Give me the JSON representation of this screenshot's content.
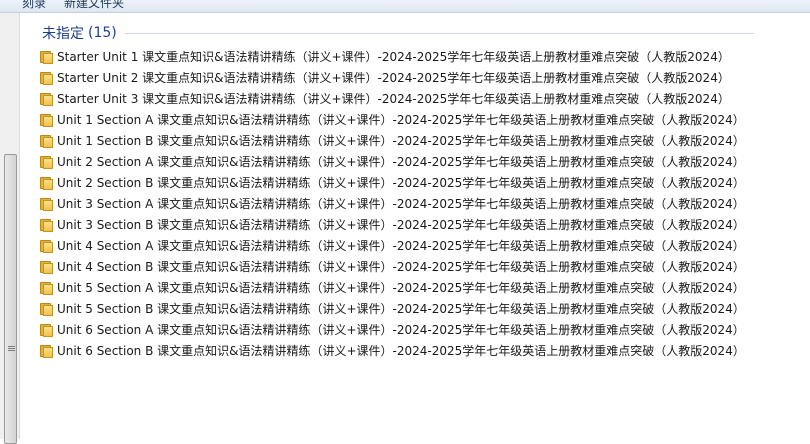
{
  "toolbar": {
    "left_label": "刻录",
    "right_label": "新建文件夹"
  },
  "group": {
    "title": "未指定",
    "count": "(15)"
  },
  "items": [
    {
      "label": "Starter Unit 1  课文重点知识&语法精讲精练（讲义+课件）-2024-2025学年七年级英语上册教材重难点突破（人教版2024）"
    },
    {
      "label": "Starter Unit 2 课文重点知识&语法精讲精练（讲义+课件）-2024-2025学年七年级英语上册教材重难点突破（人教版2024）"
    },
    {
      "label": "Starter Unit 3 课文重点知识&语法精讲精练（讲义+课件）-2024-2025学年七年级英语上册教材重难点突破（人教版2024）"
    },
    {
      "label": "Unit 1 Section A 课文重点知识&语法精讲精练（讲义+课件）-2024-2025学年七年级英语上册教材重难点突破（人教版2024）"
    },
    {
      "label": "Unit 1 Section B 课文重点知识&语法精讲精练（讲义+课件）-2024-2025学年七年级英语上册教材重难点突破（人教版2024）"
    },
    {
      "label": "Unit 2 Section A 课文重点知识&语法精讲精练（讲义+课件）-2024-2025学年七年级英语上册教材重难点突破（人教版2024）"
    },
    {
      "label": "Unit 2 Section B 课文重点知识&语法精讲精练（讲义+课件）-2024-2025学年七年级英语上册教材重难点突破（人教版2024）"
    },
    {
      "label": "Unit 3 Section A 课文重点知识&语法精讲精练（讲义+课件）-2024-2025学年七年级英语上册教材重难点突破（人教版2024）"
    },
    {
      "label": "Unit 3 Section B 课文重点知识&语法精讲精练（讲义+课件）-2024-2025学年七年级英语上册教材重难点突破（人教版2024）"
    },
    {
      "label": "Unit 4 Section A 课文重点知识&语法精讲精练（讲义+课件）-2024-2025学年七年级英语上册教材重难点突破（人教版2024）"
    },
    {
      "label": "Unit 4 Section B 课文重点知识&语法精讲精练（讲义+课件）-2024-2025学年七年级英语上册教材重难点突破（人教版2024）"
    },
    {
      "label": "Unit 5 Section A 课文重点知识&语法精讲精练（讲义+课件）-2024-2025学年七年级英语上册教材重难点突破（人教版2024）"
    },
    {
      "label": "Unit 5 Section B 课文重点知识&语法精讲精练（讲义+课件）-2024-2025学年七年级英语上册教材重难点突破（人教版2024）"
    },
    {
      "label": "Unit 6 Section A 课文重点知识&语法精讲精练（讲义+课件）-2024-2025学年七年级英语上册教材重难点突破（人教版2024）"
    },
    {
      "label": "Unit 6 Section B 课文重点知识&语法精讲精练（讲义+课件）-2024-2025学年七年级英语上册教材重难点突破（人教版2024）"
    }
  ]
}
